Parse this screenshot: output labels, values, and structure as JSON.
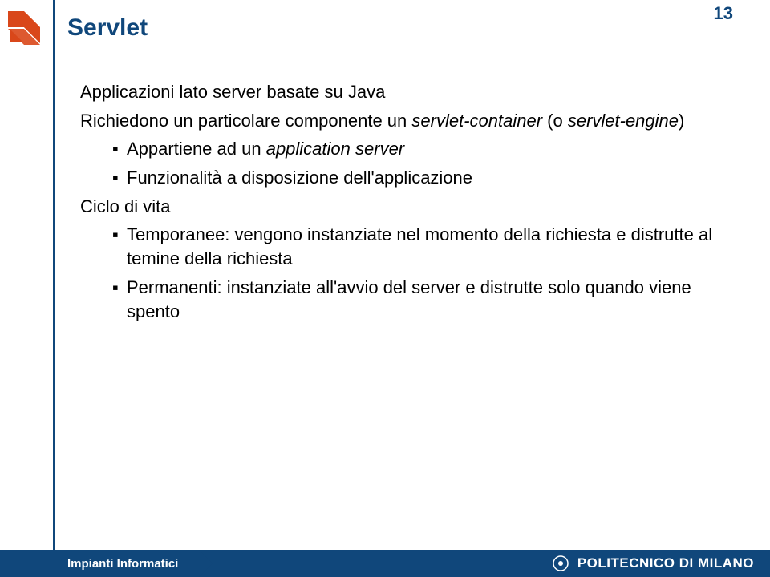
{
  "page_number": "13",
  "title": "Servlet",
  "content": {
    "p1": "Applicazioni lato server basate su Java",
    "p2a": "Richiedono un particolare componente un ",
    "p2b": "servlet-container",
    "p2c": " (o ",
    "p2d": "servlet-engine",
    "p2e": ")",
    "s1a": "Appartiene ad un ",
    "s1b": "application server",
    "s2": "Funzionalità a disposizione dell'applicazione",
    "p3": "Ciclo di vita",
    "s3": "Temporanee: vengono instanziate nel momento della richiesta e distrutte al temine della richiesta",
    "s4": "Permanenti: instanziate all'avvio del server e distrutte solo quando viene spento"
  },
  "footer": {
    "left": "Impianti Informatici",
    "right": "POLITECNICO DI MILANO"
  }
}
